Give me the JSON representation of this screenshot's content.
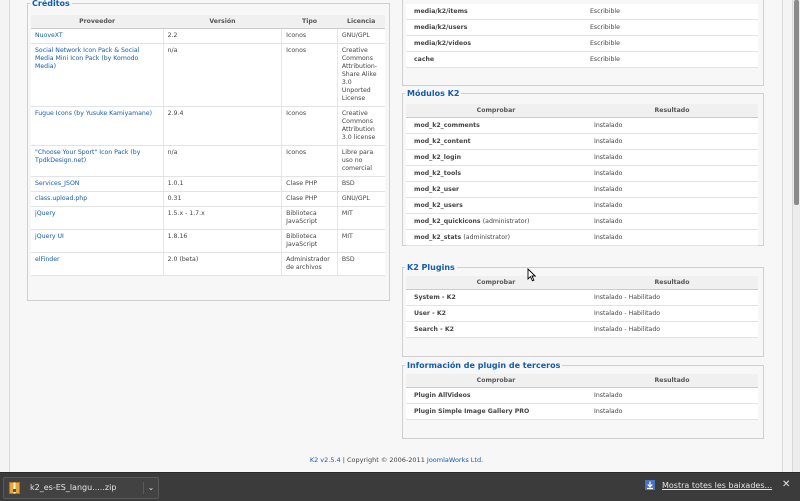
{
  "credits": {
    "legend": "Créditos",
    "columns": [
      "Proveedor",
      "Versión",
      "Tipo",
      "Licencia"
    ],
    "rows": [
      {
        "provider": "NuoveXT",
        "version": "2.2",
        "type": "Iconos",
        "license": "GNU/GPL"
      },
      {
        "provider": "Social Network Icon Pack & Social Media Mini Icon Pack (by Komodo Media)",
        "version": "n/a",
        "type": "Iconos",
        "license": "Creative Commons Attribution-Share Alike 3.0 Unported License"
      },
      {
        "provider": "Fugue Icons (by Yusuke Kamiyamane)",
        "version": "2.9.4",
        "type": "Iconos",
        "license": "Creative Commons Attribution 3.0 license"
      },
      {
        "provider": "\"Choose Your Sport\" Icon Pack (by TpdkDesign.net)",
        "version": "n/a",
        "type": "Iconos",
        "license": "Libre para uso no comercial"
      },
      {
        "provider": "Services_JSON",
        "version": "1.0.1",
        "type": "Clase PHP",
        "license": "BSD"
      },
      {
        "provider": "class.upload.php",
        "version": "0.31",
        "type": "Clase PHP",
        "license": "GNU/GPL"
      },
      {
        "provider": "jQuery",
        "version": "1.5.x - 1.7.x",
        "type": "Biblioteca JavaScript",
        "license": "MIT"
      },
      {
        "provider": "jQuery UI",
        "version": "1.8.16",
        "type": "Biblioteca JavaScript",
        "license": "MIT"
      },
      {
        "provider": "elFinder",
        "version": "2.0 (beta)",
        "type": "Administrador de archivos",
        "license": "BSD"
      }
    ]
  },
  "folders": {
    "rows": [
      {
        "path": "media/k2/items",
        "status": "Escribible"
      },
      {
        "path": "media/k2/users",
        "status": "Escribible"
      },
      {
        "path": "media/k2/videos",
        "status": "Escribible"
      },
      {
        "path": "cache",
        "status": "Escribible"
      }
    ]
  },
  "modules": {
    "legend": "Módulos K2",
    "columns": [
      "Comprobar",
      "Resultado"
    ],
    "rows": [
      {
        "name": "mod_k2_comments",
        "suffix": "",
        "result": "Instalado"
      },
      {
        "name": "mod_k2_content",
        "suffix": "",
        "result": "Instalado"
      },
      {
        "name": "mod_k2_login",
        "suffix": "",
        "result": "Instalado"
      },
      {
        "name": "mod_k2_tools",
        "suffix": "",
        "result": "Instalado"
      },
      {
        "name": "mod_k2_user",
        "suffix": "",
        "result": "Instalado"
      },
      {
        "name": "mod_k2_users",
        "suffix": "",
        "result": "Instalado"
      },
      {
        "name": "mod_k2_quickicons",
        "suffix": "(administrator)",
        "result": "Instalado"
      },
      {
        "name": "mod_k2_stats",
        "suffix": "(administrator)",
        "result": "Instalado"
      }
    ]
  },
  "plugins": {
    "legend": "K2 Plugins",
    "columns": [
      "Comprobar",
      "Resultado"
    ],
    "rows": [
      {
        "name": "System - K2",
        "result": "Instalado - Habilitado"
      },
      {
        "name": "User - K2",
        "result": "Instalado - Habilitado"
      },
      {
        "name": "Search - K2",
        "result": "Instalado - Habilitado"
      }
    ]
  },
  "third_party": {
    "legend": "Información de plugin de terceros",
    "columns": [
      "Comprobar",
      "Resultado"
    ],
    "rows": [
      {
        "name": "Plugin AllVideos",
        "result": "Instalado"
      },
      {
        "name": "Plugin Simple Image Gallery PRO",
        "result": "Instalado"
      }
    ]
  },
  "footer": {
    "version_link": "K2 v2.5.4",
    "copyright": " | Copyright © 2006-2011 ",
    "company_link": "JoomlaWorks Ltd."
  },
  "download_bar": {
    "file_name": "k2_es-ES_langu.....zip",
    "show_all": "Mostra totes les baixades...",
    "close": "✕",
    "menu_arrow": "⌄",
    "file_icon": "zip-file-icon",
    "show_all_icon": "download-arrow-icon"
  },
  "colors": {
    "link": "#135cae",
    "download_bar_bg": "#3b3b3b"
  }
}
